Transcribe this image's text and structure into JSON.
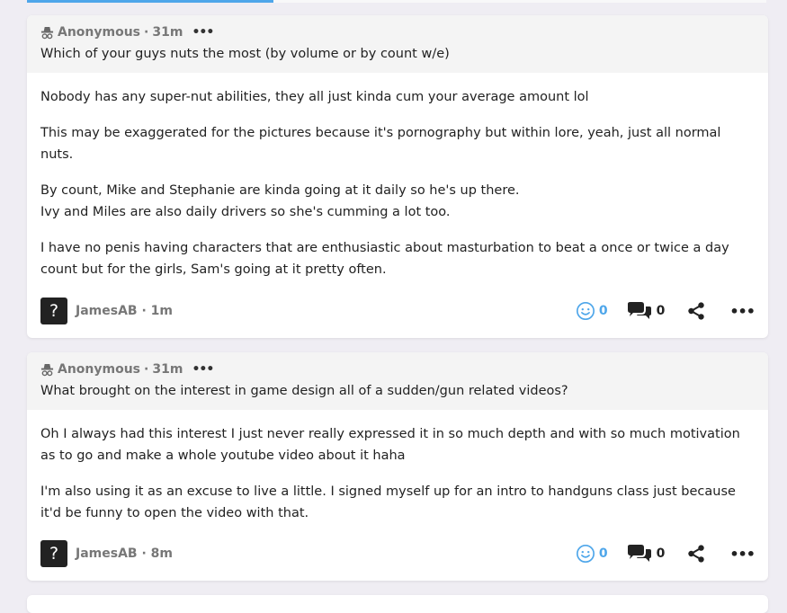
{
  "posts": [
    {
      "question": {
        "author": "Anonymous",
        "time": "31m",
        "text": "Which of your guys nuts the most (by volume or by count w/e)"
      },
      "answer_paragraphs": [
        "Nobody has any super-nut abilities, they all just kinda cum your average amount lol",
        "This may be exaggerated for the pictures because it's pornography but within lore, yeah, just all normal nuts.",
        "By count, Mike and Stephanie are kinda going at it daily so he's up there.\nIvy and Miles are also daily drivers so she's cumming a lot too.",
        "I have no penis having characters that are enthusiastic about masturbation to beat a once or twice a day count but for the girls, Sam's going at it pretty often."
      ],
      "answer_author": "JamesAB",
      "answer_time": "1m",
      "avatar_glyph": "?",
      "reactions": "0",
      "comments": "0"
    },
    {
      "question": {
        "author": "Anonymous",
        "time": "31m",
        "text": "What brought on the interest in game design all of a sudden/gun related videos?"
      },
      "answer_paragraphs": [
        "Oh I always had this interest I just never really expressed it in so much depth and with so much motivation as to go and make a whole youtube video about it haha",
        "I'm also using it as an excuse to live a little. I signed myself up for an intro to handguns class just because it'd be funny to open the video with that."
      ],
      "answer_author": "JamesAB",
      "answer_time": "8m",
      "avatar_glyph": "?",
      "reactions": "0",
      "comments": "0"
    }
  ],
  "colors": {
    "accent": "#4ea6ea",
    "page_bg": "#efedf3",
    "header_bg": "#f4f4f4",
    "meta_text": "#777777"
  },
  "icons": {
    "anon": "incognito-icon",
    "reaction": "smiley-icon",
    "comment": "comments-icon",
    "share": "share-icon",
    "more": "ellipsis-icon"
  },
  "separators": {
    "meta_dot": "·",
    "ellipsis": "•••"
  }
}
